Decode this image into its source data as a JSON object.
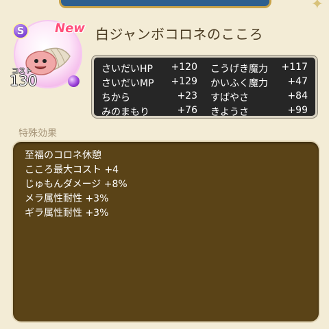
{
  "card": {
    "rank": "S",
    "new_badge": "New",
    "cost_label": "コスト",
    "cost": "130",
    "title": "白ジャンボコロネのこころ"
  },
  "stats": [
    {
      "name": "さいだいHP",
      "value": "+120"
    },
    {
      "name": "こうげき魔力",
      "value": "+117"
    },
    {
      "name": "さいだいMP",
      "value": "+129"
    },
    {
      "name": "かいふく魔力",
      "value": "+47"
    },
    {
      "name": "ちから",
      "value": "+23"
    },
    {
      "name": "すばやさ",
      "value": "+84"
    },
    {
      "name": "みのまもり",
      "value": "+76"
    },
    {
      "name": "きようさ",
      "value": "+99"
    }
  ],
  "effects_section": {
    "label": "特殊効果",
    "items": [
      "至福のコロネ休憩",
      "こころ最大コスト +4",
      "じゅもんダメージ +8%",
      "メラ属性耐性 +3%",
      "ギラ属性耐性 +3%"
    ]
  },
  "colors": {
    "stats_bg": "#262626",
    "effects_bg": "#5a4317",
    "page_bg": "#f3ecd6",
    "rank_purple": "#8a4fe0",
    "new_pink": "#ff4f7a"
  },
  "icons": [
    "rank-s-badge",
    "new-badge",
    "corone-monster",
    "purple-gem",
    "sparkle-icon"
  ]
}
